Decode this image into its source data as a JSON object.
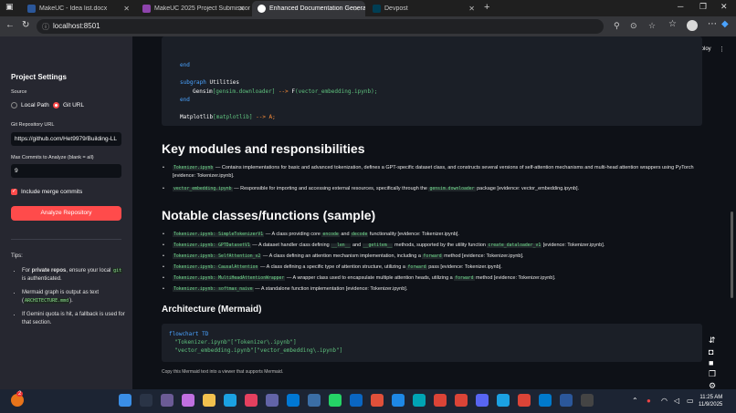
{
  "browser": {
    "tabs": [
      {
        "label": "MakeUC - Idea list.docx",
        "color": "#2b579a",
        "active": false
      },
      {
        "label": "MakeUC 2025 Project Submission",
        "color": "#8e44ad",
        "active": false
      },
      {
        "label": "Enhanced Documentation Genera",
        "color": "#ffffff",
        "active": true
      },
      {
        "label": "Devpost",
        "color": "#003e54",
        "active": false
      }
    ],
    "url": "localhost:8501"
  },
  "app": {
    "deploy": "Deploy",
    "sidebar": {
      "title": "Project Settings",
      "source_label": "Source",
      "source_options": [
        "Local Path",
        "Git URL"
      ],
      "selected_source": "Git URL",
      "repo_label": "Git Repository URL",
      "repo_value": "https://github.com/Het9979/Building-LL",
      "commits_label": "Max Commits to Analyze (blank = all)",
      "commits_value": "9",
      "merge_label": "Include merge commits",
      "analyze_button": "Analyze Repository",
      "tips_title": "Tips:",
      "tip1_pre": "For ",
      "tip1_bold": "private repos",
      "tip1_mid": ", ensure your local ",
      "tip1_code": "git",
      "tip1_post": " is authenticated.",
      "tip2_pre": "Mermaid graph is output as text (",
      "tip2_code": "ARCHITECTURE.mmd",
      "tip2_post": ").",
      "tip3": "If Gemini quota is hit, a fallback is used for that section."
    },
    "code_top": {
      "line1": "end",
      "line2_kw": "subgraph",
      "line2_rest": " Utilities",
      "line3_a": "Gensim",
      "line3_b": "[gensim.downloader]",
      "line3_c": " --> ",
      "line3_d": "F",
      "line3_e": "(vector_embedding.ipynb);",
      "line4": "end",
      "line5_a": "Matplotlib",
      "line5_b": "[matplotlib]",
      "line5_c": " --> A;"
    },
    "modules_heading": "Key modules and responsibilities",
    "modules": [
      {
        "code": "Tokenizer.ipynb",
        "text": " — Contains implementations for basic and advanced tokenization, defines a GPT-specific dataset class, and constructs several versions of self-attention mechanisms and multi-head attention wrappers using PyTorch [evidence: Tokenizer.ipynb]."
      },
      {
        "code": "vector_embedding.ipynb",
        "text": " — Responsible for importing and accessing external resources, specifically through the ",
        "code2": "gensim.downloader",
        "text2": " package [evidence: vector_embedding.ipynb]."
      }
    ],
    "classes_heading": "Notable classes/functions (sample)",
    "classes": [
      {
        "code": "Tokenizer.ipynb: SimpleTokenizerV1",
        "text": " — A class providing core ",
        "c2": "encode",
        "t2": " and ",
        "c3": "decode",
        "t3": " functionality [evidence: Tokenizer.ipynb]."
      },
      {
        "code": "Tokenizer.ipynb: GPTDatasetV1",
        "text": " — A dataset handler class defining ",
        "c2": "__len__",
        "t2": " and ",
        "c3": "__getitem__",
        "t3": " methods, supported by the utility function ",
        "c4": "create_dataloader_v1",
        "t4": " [evidence: Tokenizer.ipynb]."
      },
      {
        "code": "Tokenizer.ipynb: SelfAttention_v2",
        "text": " — A class defining an attention mechanism implementation, including a ",
        "c2": "forward",
        "t2": " method [evidence: Tokenizer.ipynb]."
      },
      {
        "code": "Tokenizer.ipynb: CausalAttention",
        "text": " — A class defining a specific type of attention structure, utilizing a ",
        "c2": "forward",
        "t2": " pass [evidence: Tokenizer.ipynb]."
      },
      {
        "code": "Tokenizer.ipynb: MultiHeadAttentionWrapper",
        "text": " — A wrapper class used to encapsulate multiple attention heads, utilizing a ",
        "c2": "forward",
        "t2": " method [evidence: Tokenizer.ipynb]."
      },
      {
        "code": "Tokenizer.ipynb: softmax_naive",
        "text": " — A standalone function implementation [evidence: Tokenizer.ipynb]."
      }
    ],
    "arch_heading": "Architecture (Mermaid)",
    "arch_code": {
      "l1": "flowchart TD",
      "l2": "\"Tokenizer.ipynb\"[\"Tokenizer\\.ipynb\"]",
      "l3": "\"vector_embedding.ipynb\"[\"vector_embedding\\.ipynb\"]"
    },
    "caption": "Copy this Mermaid text into a viewer that supports Mermaid."
  },
  "taskbar": {
    "time": "11:25 AM",
    "date": "11/9/2025",
    "badge": "2"
  }
}
